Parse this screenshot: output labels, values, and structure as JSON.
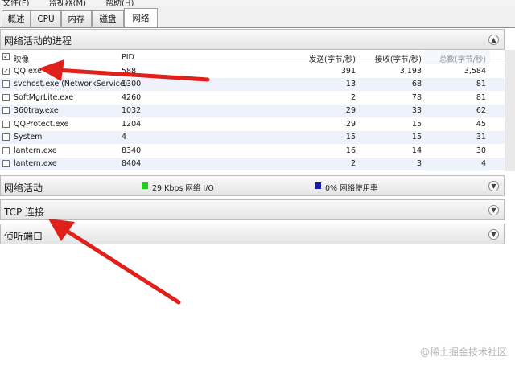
{
  "menubar": {
    "items": [
      "文件(F)",
      "监视器(M)",
      "帮助(H)"
    ]
  },
  "tabs": [
    {
      "label": "概述"
    },
    {
      "label": "CPU"
    },
    {
      "label": "内存"
    },
    {
      "label": "磁盘"
    },
    {
      "label": "网络"
    }
  ],
  "network_activity_processes": {
    "title": "网络活动的进程",
    "columns": {
      "image": "映像",
      "pid": "PID",
      "send": "发送(字节/秒)",
      "receive": "接收(字节/秒)",
      "total": "总数(字节/秒)"
    },
    "rows": [
      {
        "checked": "✓",
        "image": "QQ.exe",
        "pid": "588",
        "send": "391",
        "receive": "3,193",
        "total": "3,584"
      },
      {
        "checked": "",
        "image": "svchost.exe (NetworkService)",
        "pid": "1300",
        "send": "13",
        "receive": "68",
        "total": "81"
      },
      {
        "checked": "",
        "image": "SoftMgrLite.exe",
        "pid": "4260",
        "send": "2",
        "receive": "78",
        "total": "81"
      },
      {
        "checked": "",
        "image": "360tray.exe",
        "pid": "1032",
        "send": "29",
        "receive": "33",
        "total": "62"
      },
      {
        "checked": "",
        "image": "QQProtect.exe",
        "pid": "1204",
        "send": "29",
        "receive": "15",
        "total": "45"
      },
      {
        "checked": "",
        "image": "System",
        "pid": "4",
        "send": "15",
        "receive": "15",
        "total": "31"
      },
      {
        "checked": "",
        "image": "lantern.exe",
        "pid": "8340",
        "send": "16",
        "receive": "14",
        "total": "30"
      },
      {
        "checked": "",
        "image": "lantern.exe",
        "pid": "8404",
        "send": "2",
        "receive": "3",
        "total": "4"
      }
    ]
  },
  "network_activity": {
    "title": "网络活动",
    "io_text": "29 Kbps 网络 I/O",
    "io_color": "#22cc22",
    "usage_text": "0% 网络使用率",
    "usage_color": "#1a1aa0"
  },
  "tcp_connections": {
    "title": "TCP 连接"
  },
  "listening_ports": {
    "title": "侦听端口"
  },
  "icons": {
    "collapse_up": "▲",
    "expand_down": "▼"
  },
  "annotation_color": "#e0201a",
  "watermark": "@稀土掘金技术社区"
}
